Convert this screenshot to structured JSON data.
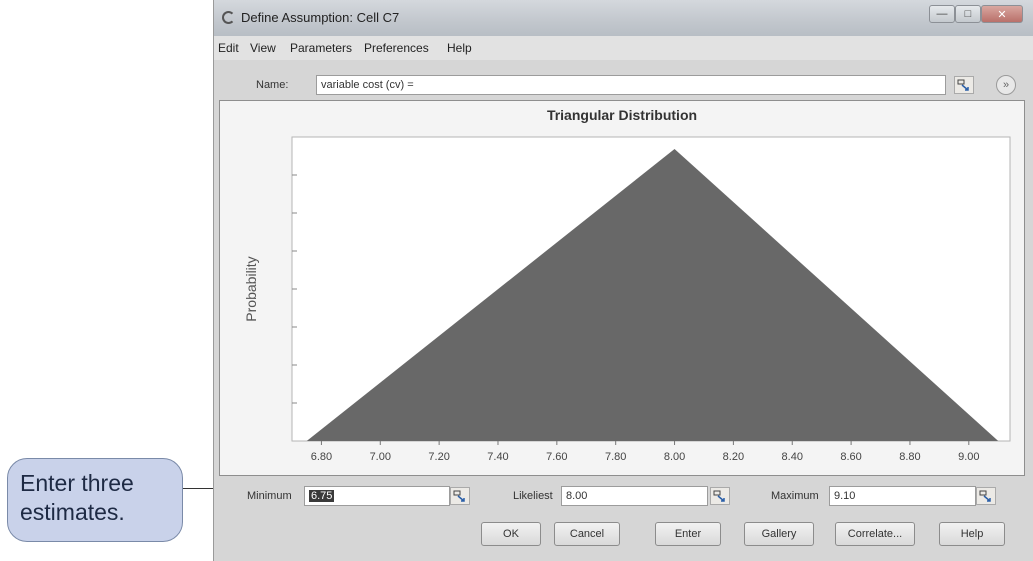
{
  "callout": {
    "line1": "Enter three",
    "line2": "estimates."
  },
  "window": {
    "title": "Define Assumption: Cell C7"
  },
  "menu": [
    "Edit",
    "View",
    "Parameters",
    "Preferences",
    "Help"
  ],
  "name": {
    "label": "Name:",
    "value": "variable cost (cv) ="
  },
  "chart_data": {
    "type": "area",
    "title": "Triangular Distribution",
    "ylabel": "Probability",
    "xlabel": "",
    "x_ticks": [
      "6.80",
      "7.00",
      "7.20",
      "7.40",
      "7.60",
      "7.80",
      "8.00",
      "8.20",
      "8.40",
      "8.60",
      "8.80",
      "9.00"
    ],
    "xlim": [
      6.7,
      9.14
    ],
    "x": [
      6.75,
      8.0,
      9.1
    ],
    "y": [
      0,
      1,
      0
    ],
    "fill_color": "#686868",
    "grid": false
  },
  "params": {
    "minimum_label": "Minimum",
    "minimum_value": "6.75",
    "likeliest_label": "Likeliest",
    "likeliest_value": "8.00",
    "maximum_label": "Maximum",
    "maximum_value": "9.10"
  },
  "buttons": {
    "ok": "OK",
    "cancel": "Cancel",
    "enter": "Enter",
    "gallery": "Gallery",
    "correlate": "Correlate...",
    "help": "Help"
  }
}
